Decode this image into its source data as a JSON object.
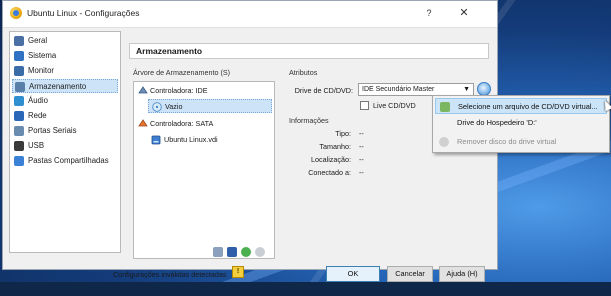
{
  "window": {
    "title": "Ubuntu Linux - Configurações",
    "help_label": "?",
    "close_label": "✕"
  },
  "sidebar": {
    "items": [
      {
        "label": "Geral",
        "icon": "general-icon",
        "color": "#4a6fa5"
      },
      {
        "label": "Sistema",
        "icon": "system-icon",
        "color": "#2f72c4"
      },
      {
        "label": "Monitor",
        "icon": "monitor-icon",
        "color": "#3a6da8"
      },
      {
        "label": "Armazenamento",
        "icon": "storage-icon",
        "color": "#5a7fa8",
        "selected": true
      },
      {
        "label": "Áudio",
        "icon": "audio-icon",
        "color": "#2f8fd0"
      },
      {
        "label": "Rede",
        "icon": "network-icon",
        "color": "#2a67b8"
      },
      {
        "label": "Portas Seriais",
        "icon": "serial-ports-icon",
        "color": "#6a8bb0"
      },
      {
        "label": "USB",
        "icon": "usb-icon",
        "color": "#3a3a3a"
      },
      {
        "label": "Pastas Compartilhadas",
        "icon": "shared-folders-icon",
        "color": "#3b82d6"
      }
    ]
  },
  "header": {
    "title": "Armazenamento"
  },
  "tree": {
    "label": "Árvore de Armazenamento (S)",
    "rows": [
      {
        "label": "Controladora: IDE",
        "icon": "ide-controller-icon"
      },
      {
        "label": "Vazio",
        "icon": "empty-disc-icon",
        "selected": true
      },
      {
        "label": "Controladora: SATA",
        "icon": "sata-controller-icon"
      },
      {
        "label": "Ubuntu Linux.vdi",
        "icon": "hard-disk-icon"
      }
    ]
  },
  "attributes": {
    "label": "Atributos",
    "drive_label": "Drive de CD/DVD:",
    "drive_value": "IDE Secundário Master",
    "live_label": "Live CD/DVD",
    "live_checked": false
  },
  "info": {
    "label": "Informações",
    "rows": [
      {
        "key": "Tipo:",
        "value": "--"
      },
      {
        "key": "Tamanho:",
        "value": "--"
      },
      {
        "key": "Localização:",
        "value": "--"
      },
      {
        "key": "Conectado a:",
        "value": "--"
      }
    ]
  },
  "footer": {
    "invalid_text": "Configurações inválidas detectadas",
    "ok_label": "OK",
    "cancel_label": "Cancelar",
    "help_label": "Ajuda (H)"
  },
  "popup": {
    "items": [
      {
        "label": "Selecione um arquivo de CD/DVD virtual...",
        "highlighted": true,
        "disabled": false
      },
      {
        "label": "Drive do Hospedeiro 'D:'",
        "highlighted": false,
        "disabled": false
      },
      {
        "label": "Remover disco do drive virtual",
        "highlighted": false,
        "disabled": true
      }
    ]
  }
}
